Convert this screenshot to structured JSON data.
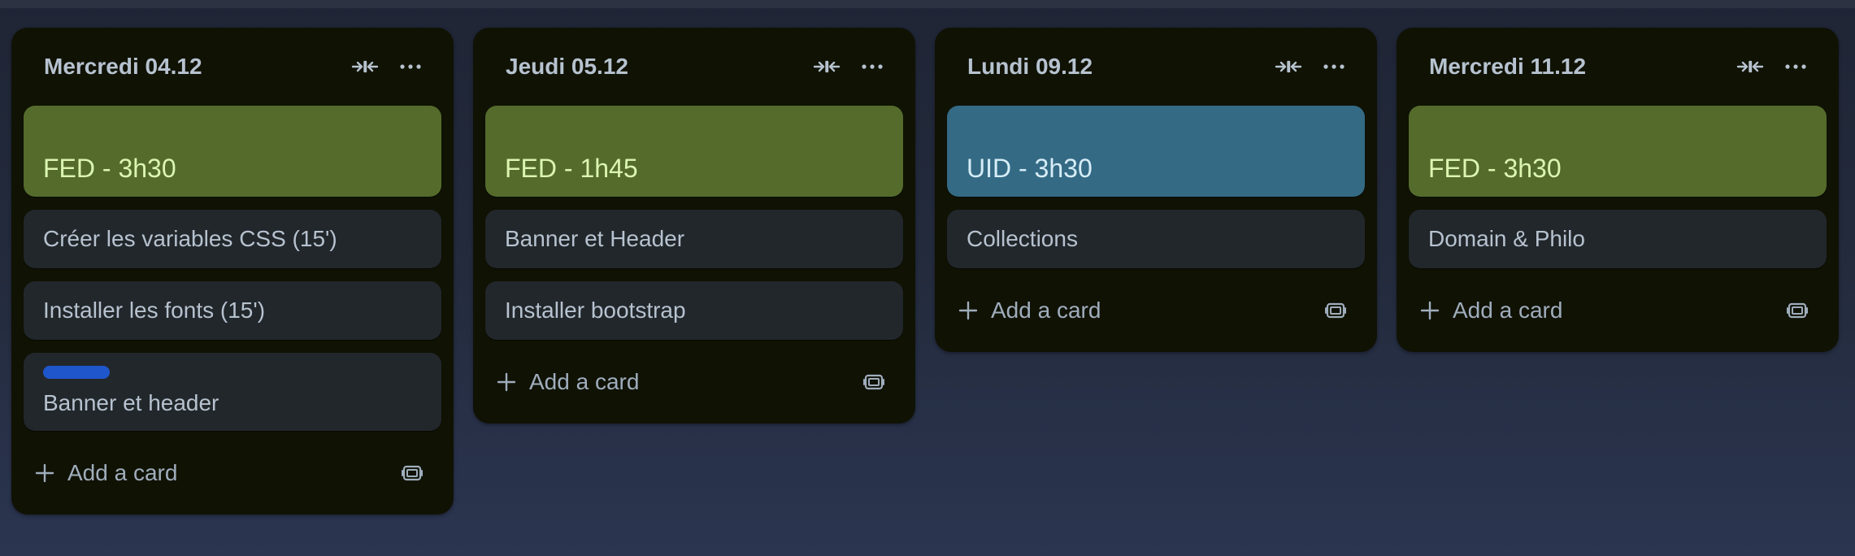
{
  "board": {
    "add_card_label": "Add a card",
    "lists": [
      {
        "title": "Mercredi 04.12",
        "cover": {
          "text": "FED - 3h30",
          "color": "#546b2c"
        },
        "cards": [
          "Créer les variables CSS (15')",
          "Installer les fonts (15')"
        ],
        "labeled_card": {
          "text": "Banner et header",
          "label_color": "#1f56cc"
        }
      },
      {
        "title": "Jeudi 05.12",
        "cover": {
          "text": "FED - 1h45",
          "color": "#546b2c"
        },
        "cards": [
          "Banner et Header",
          "Installer bootstrap"
        ]
      },
      {
        "title": "Lundi 09.12",
        "cover": {
          "text": "UID - 3h30",
          "color": "#346a84"
        },
        "cards": [
          "Collections"
        ]
      },
      {
        "title": "Mercredi 11.12",
        "cover": {
          "text": "FED - 3h30",
          "color": "#546b2c"
        },
        "cards": [
          "Domain & Philo"
        ]
      }
    ]
  },
  "icons": {
    "collapse": "collapse-arrows-icon",
    "more": "more-dots-icon",
    "plus": "plus-icon",
    "template": "card-template-icon"
  }
}
